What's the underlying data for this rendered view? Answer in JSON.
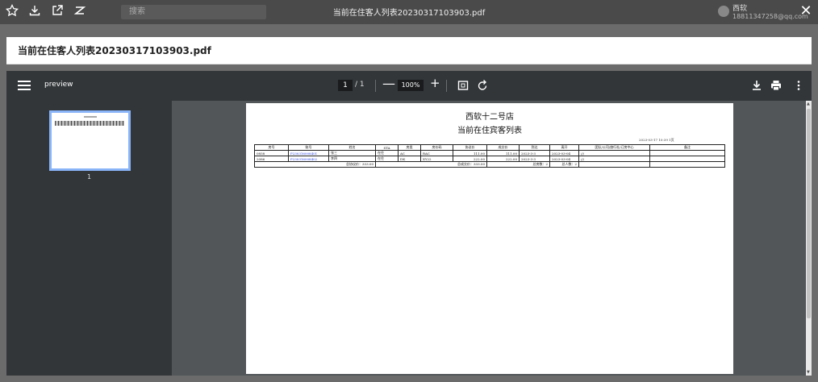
{
  "browser": {
    "search_placeholder": "搜索",
    "file_title": "当前在住客人列表20230317103903.pdf",
    "user_name": "西软",
    "user_detail": "18811347258@qq.com",
    "close_glyph": "✕"
  },
  "dialog": {
    "title": "当前在住客人列表20230317103903.pdf"
  },
  "toolbar": {
    "preview_label": "preview",
    "page_current": "1",
    "page_total": "/ 1",
    "zoom_out_glyph": "—",
    "zoom_value": "100%",
    "zoom_in_glyph": "+"
  },
  "sidebar": {
    "thumb_page_number": "1"
  },
  "document": {
    "hotel_name": "西软十二号店",
    "title": "当前在住宾客列表",
    "print_time": "2023-03-17 10:39 1页",
    "columns": [
      "房号",
      "账号",
      "姓名",
      "STA",
      "房类",
      "房价码",
      "协议价",
      "成交价",
      "到达",
      "离开",
      "团队/公司/旅行社/订房中心",
      "备注"
    ],
    "rows": [
      [
        "0858",
        "P230316008401",
        "张三",
        "在住",
        "AC",
        "RAC",
        "111.00",
        "111.00",
        "2023-3-3",
        "2023-03-04",
        "///",
        ""
      ],
      [
        "2086",
        "P230316008402",
        "李四",
        "在住",
        "DK",
        "XY22",
        "222.00",
        "222.00",
        "2023-3-3",
        "2023-03-04",
        "///",
        ""
      ]
    ],
    "summary": {
      "total_agreed": "总协议价：333.00",
      "total_deal": "总成交价：333.00",
      "total_rooms": "总房数：2",
      "total_people": "总人数：2"
    }
  }
}
